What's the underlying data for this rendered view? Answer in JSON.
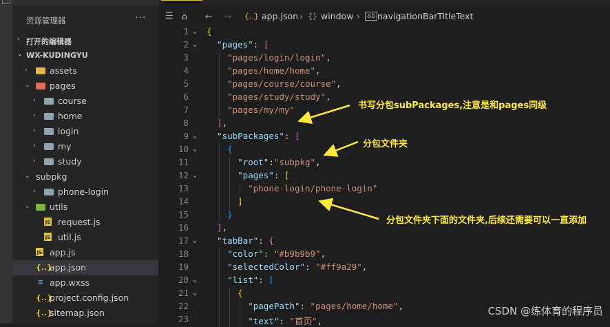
{
  "sidebar": {
    "title": "资源管理器",
    "more": "···",
    "open_editors": "打开的编辑器",
    "project": "WX-KUDINGYU",
    "tree": [
      {
        "name": "assets",
        "icon": "folder-icon",
        "depth": 1,
        "chev": "›"
      },
      {
        "name": "pages",
        "icon": "folder-open-icon",
        "depth": 1,
        "chev": "⌄"
      },
      {
        "name": "course",
        "icon": "folder-icon",
        "depth": 2,
        "chev": "›"
      },
      {
        "name": "home",
        "icon": "folder-icon",
        "depth": 2,
        "chev": "›"
      },
      {
        "name": "login",
        "icon": "folder-icon",
        "depth": 2,
        "chev": "›"
      },
      {
        "name": "my",
        "icon": "folder-icon",
        "depth": 2,
        "chev": "›"
      },
      {
        "name": "study",
        "icon": "folder-icon",
        "depth": 2,
        "chev": "›"
      },
      {
        "name": "subpkg",
        "icon": "",
        "depth": 1,
        "chev": "⌄"
      },
      {
        "name": "phone-login",
        "icon": "folder-icon",
        "depth": 2,
        "chev": "›"
      },
      {
        "name": "utils",
        "icon": "folder-open-icon",
        "depth": 1,
        "chev": "⌄"
      },
      {
        "name": "request.js",
        "icon": "js-file-icon",
        "depth": 2,
        "chev": ""
      },
      {
        "name": "util.js",
        "icon": "js-file-icon",
        "depth": 2,
        "chev": ""
      },
      {
        "name": "app.js",
        "icon": "js-file-icon",
        "depth": 1,
        "chev": ""
      },
      {
        "name": "app.json",
        "icon": "json-file-icon",
        "depth": 1,
        "chev": "",
        "selected": true
      },
      {
        "name": "app.wxss",
        "icon": "css-file-icon",
        "depth": 1,
        "chev": ""
      },
      {
        "name": "project.config.json",
        "icon": "json-file-icon",
        "depth": 1,
        "chev": ""
      },
      {
        "name": "sitemap.json",
        "icon": "json-file-icon",
        "depth": 1,
        "chev": ""
      }
    ]
  },
  "breadcrumb": {
    "file": "app.json",
    "section": "window",
    "field": "navigationBarTitleText"
  },
  "code": {
    "start_line": 1,
    "lines": [
      "{",
      "  \"pages\": [",
      "    \"pages/login/login\",",
      "    \"pages/home/home\",",
      "    \"pages/course/course\",",
      "    \"pages/study/study\",",
      "    \"pages/my/my\"",
      "  ],",
      "  \"subPackages\": [",
      "    {",
      "      \"root\":\"subpkg\",",
      "      \"pages\": [",
      "        \"phone-login/phone-login\"",
      "      ]",
      "    }",
      "  ],",
      "  \"tabBar\": {",
      "    \"color\": \"#b9b9b9\",",
      "    \"selectedColor\": \"#ff9a29\",",
      "    \"list\": [",
      "      {",
      "        \"pagePath\": \"pages/home/home\",",
      "        \"text\": \"首页\","
    ]
  },
  "annotations": [
    "书写分包subPackages,注意是和pages同级",
    "分包文件夹",
    "分包文件夹下面的文件夹,后续还需要可以一直添加"
  ],
  "watermark": "CSDN @练体育的程序员",
  "colors": {
    "annotation": "#ffeb3b",
    "key": "#9cdcfe",
    "string": "#ce9178"
  }
}
